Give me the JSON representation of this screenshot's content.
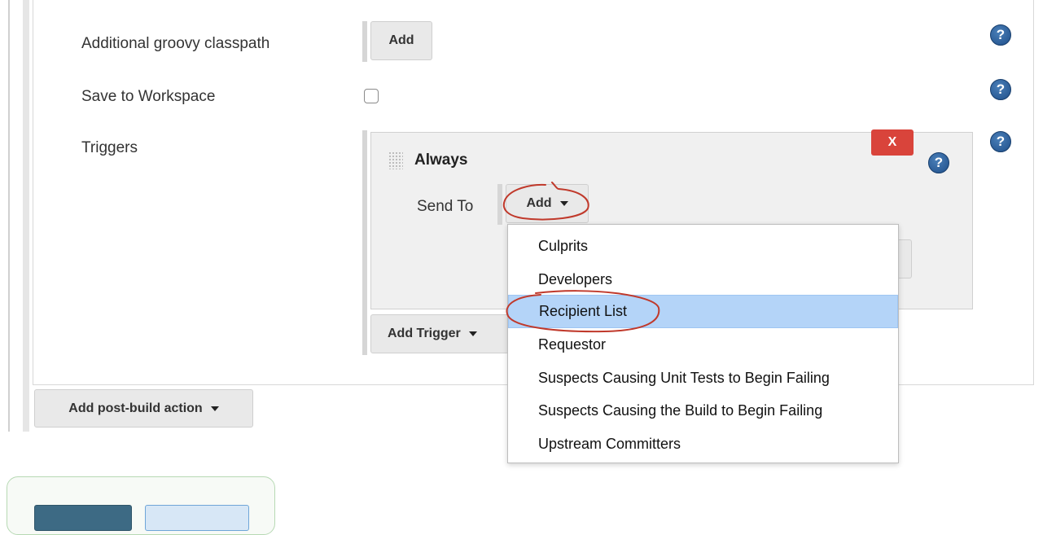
{
  "form": {
    "groovy_classpath": {
      "label": "Additional groovy classpath",
      "button": "Add"
    },
    "save_workspace": {
      "label": "Save to Workspace",
      "checked": false
    },
    "triggers": {
      "label": "Triggers"
    }
  },
  "trigger": {
    "title": "Always",
    "delete_label": "X",
    "send_to_label": "Send To",
    "add_button": "Add"
  },
  "add_trigger_button": "Add Trigger",
  "add_post_build_button": "Add post-build action",
  "help_glyph": "?",
  "dropdown": {
    "items": [
      "Culprits",
      "Developers",
      "Recipient List",
      "Requestor",
      "Suspects Causing Unit Tests to Begin Failing",
      "Suspects Causing the Build to Begin Failing",
      "Upstream Committers"
    ],
    "selected": "Recipient List"
  },
  "colors": {
    "delete_button": "#d9443b",
    "selected_item": "#b4d4f8",
    "help_icon": "#2a5d9a",
    "annotation": "#c0392b"
  },
  "icons": [
    "help-icon",
    "drag-handle-icon",
    "caret-down-icon"
  ]
}
